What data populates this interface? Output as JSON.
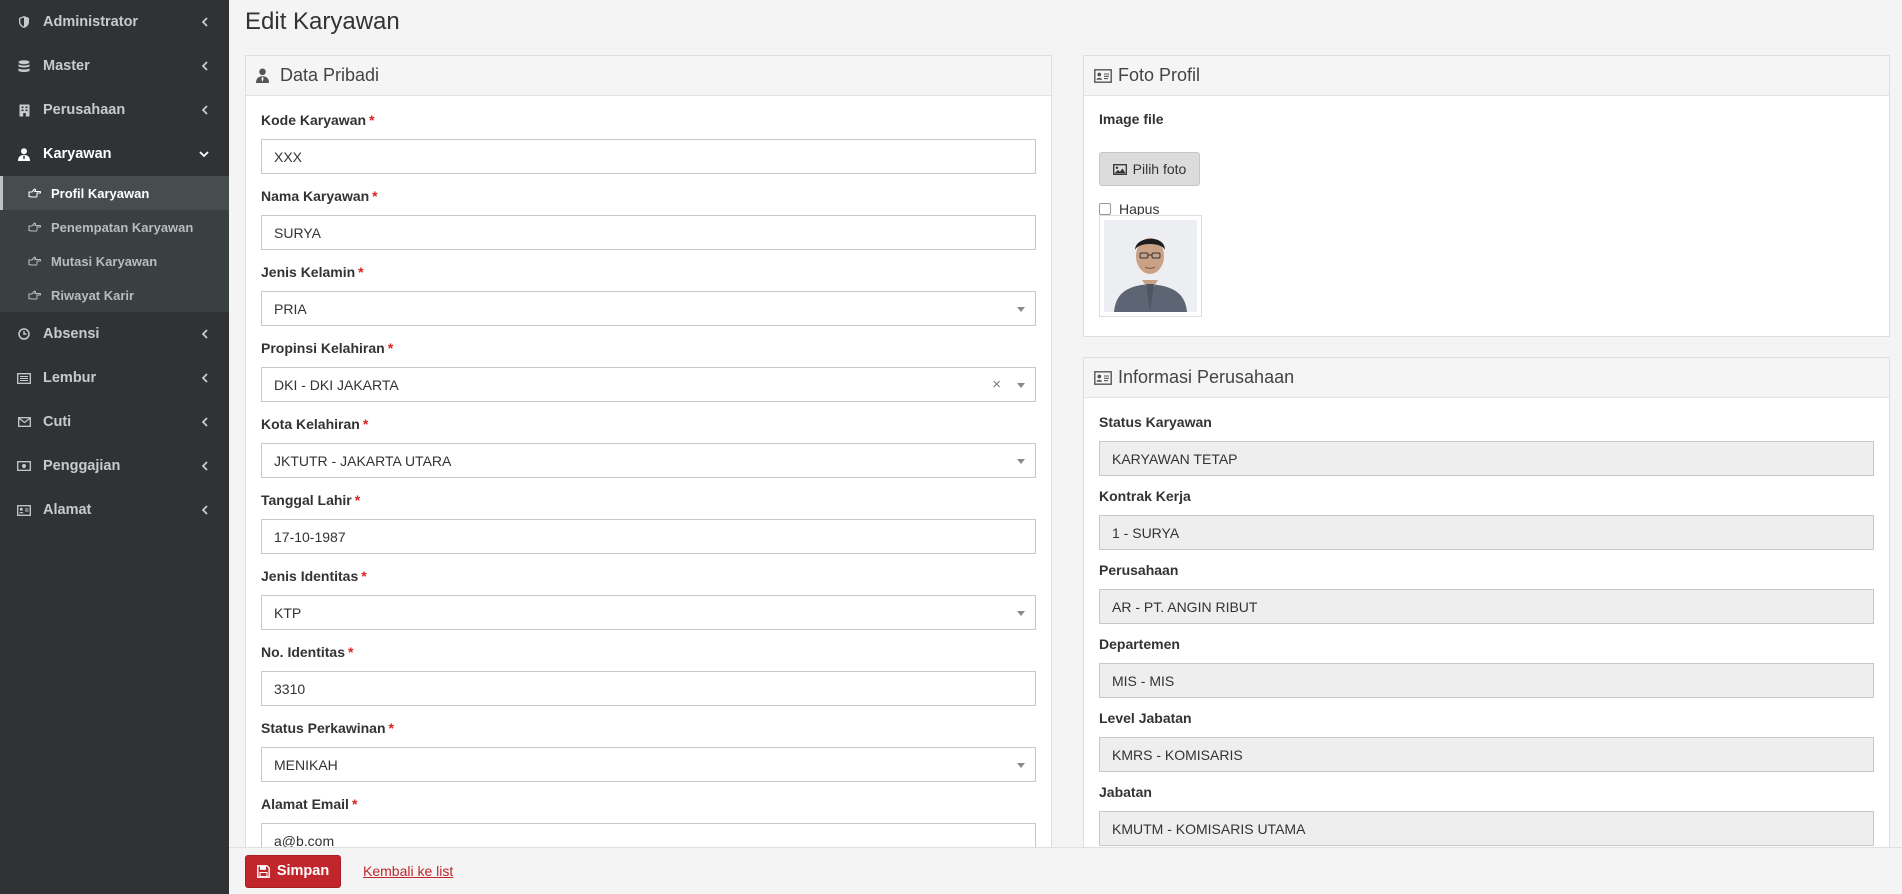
{
  "sidebar": {
    "items": [
      {
        "label": "Administrator",
        "icon": "shield-icon"
      },
      {
        "label": "Master",
        "icon": "database-icon"
      },
      {
        "label": "Perusahaan",
        "icon": "building-icon"
      },
      {
        "label": "Karyawan",
        "icon": "user-icon"
      },
      {
        "label": "Absensi",
        "icon": "clock-icon"
      },
      {
        "label": "Lembur",
        "icon": "list-icon"
      },
      {
        "label": "Cuti",
        "icon": "envelope-icon"
      },
      {
        "label": "Penggajian",
        "icon": "money-icon"
      },
      {
        "label": "Alamat",
        "icon": "address-card-icon"
      }
    ],
    "subitems": [
      {
        "label": "Profil Karyawan"
      },
      {
        "label": "Penempatan Karyawan"
      },
      {
        "label": "Mutasi Karyawan"
      },
      {
        "label": "Riwayat Karir"
      }
    ]
  },
  "page": {
    "title": "Edit Karyawan"
  },
  "pribadi": {
    "title": "Data Pribadi",
    "fields": [
      {
        "label": "Kode Karyawan",
        "value": "XXX"
      },
      {
        "label": "Nama Karyawan",
        "value": "SURYA"
      },
      {
        "label": "Jenis Kelamin",
        "value": "PRIA"
      },
      {
        "label": "Propinsi Kelahiran",
        "value": "DKI - DKI JAKARTA"
      },
      {
        "label": "Kota Kelahiran",
        "value": "JKTUTR - JAKARTA UTARA"
      },
      {
        "label": "Tanggal Lahir",
        "value": "17-10-1987"
      },
      {
        "label": "Jenis Identitas",
        "value": "KTP"
      },
      {
        "label": "No. Identitas",
        "value": "3310"
      },
      {
        "label": "Status Perkawinan",
        "value": "MENIKAH"
      },
      {
        "label": "Alamat Email",
        "value": "a@b.com"
      }
    ],
    "required_mark": "*",
    "clear_glyph": "×"
  },
  "foto": {
    "title": "Foto Profil",
    "image_label": "Image file",
    "choose_button": "Pilih foto",
    "delete_label": "Hapus"
  },
  "perusahaan": {
    "title": "Informasi Perusahaan",
    "fields": [
      {
        "label": "Status Karyawan",
        "value": "KARYAWAN TETAP"
      },
      {
        "label": "Kontrak Kerja",
        "value": "1 - SURYA"
      },
      {
        "label": "Perusahaan",
        "value": "AR - PT. ANGIN RIBUT"
      },
      {
        "label": "Departemen",
        "value": "MIS - MIS"
      },
      {
        "label": "Level Jabatan",
        "value": "KMRS - KOMISARIS"
      },
      {
        "label": "Jabatan",
        "value": "KMUTM - KOMISARIS UTAMA"
      }
    ]
  },
  "footer": {
    "save_label": "Simpan",
    "back_label": "Kembali ke list"
  },
  "colors": {
    "sidebar_bg": "#2f3335",
    "primary_red": "#c0262c",
    "required_red": "#dd2222"
  }
}
